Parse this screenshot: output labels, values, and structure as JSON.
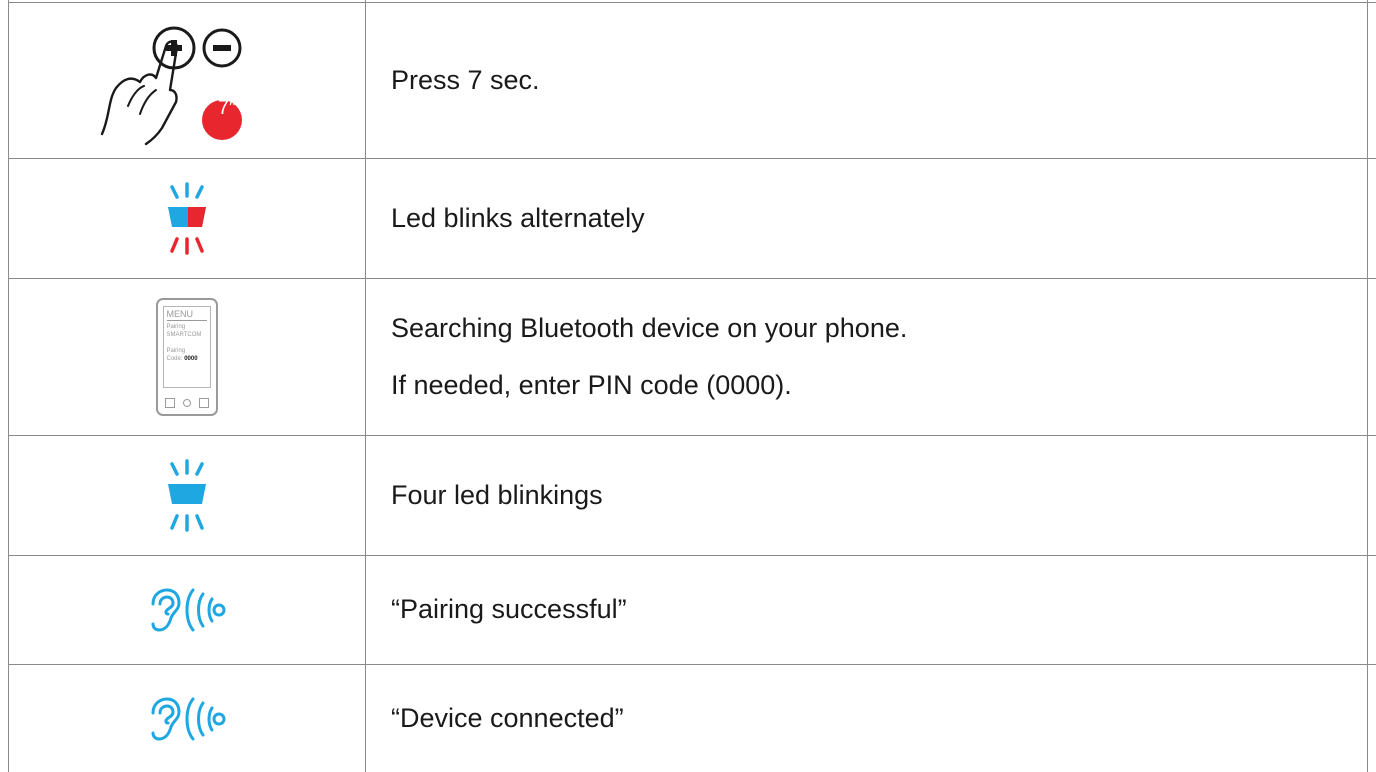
{
  "colors": {
    "border": "#8a8a8a",
    "blue": "#1ea7e1",
    "red": "#e8262d",
    "grey": "#9a9a9a"
  },
  "rows": [
    {
      "icon": "hand-press-plus-minus-icon",
      "badge": "7″",
      "text": [
        "Press 7 sec."
      ]
    },
    {
      "icon": "led-blink-blue-red-icon",
      "text": [
        "Led blinks alternately"
      ]
    },
    {
      "icon": "phone-pairing-screen-icon",
      "phone": {
        "menu": "MENU",
        "pairing": "Pairing",
        "device": "SMARTCOM",
        "pairing_code_label": "Pairing",
        "code_label": "Code:",
        "code": "0000"
      },
      "text": [
        "Searching Bluetooth device on your phone.",
        "If needed, enter PIN code (0000)."
      ]
    },
    {
      "icon": "led-blink-blue-icon",
      "text": [
        "Four led blinkings"
      ]
    },
    {
      "icon": "ear-sound-icon",
      "text": [
        "“Pairing successful”"
      ]
    },
    {
      "icon": "ear-sound-icon",
      "text": [
        "“Device connected”"
      ]
    }
  ]
}
